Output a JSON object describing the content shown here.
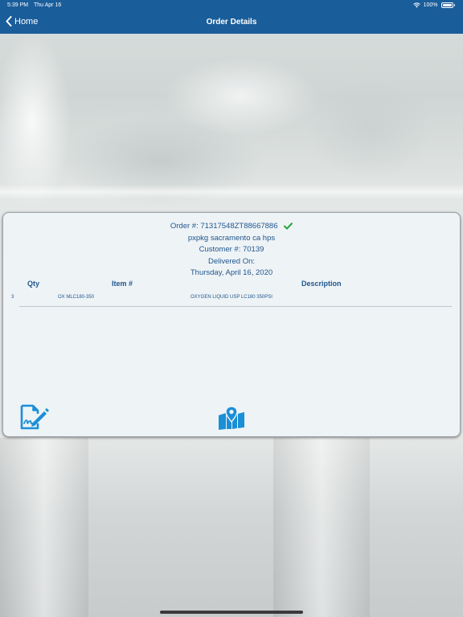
{
  "status_bar": {
    "time": "5:39 PM",
    "date": "Thu Apr 16",
    "battery": "100%"
  },
  "nav": {
    "back_label": "Home",
    "title": "Order Details"
  },
  "order": {
    "order_number": "Order #: 71317548ZT88667886",
    "location": "pxpkg sacramento ca hps",
    "customer": "Customer #: 70139",
    "delivered_label": "Delivered On:",
    "delivered_date": "Thursday, April 16, 2020"
  },
  "table": {
    "headers": {
      "qty": "Qty",
      "item": "Item #",
      "description": "Description"
    },
    "rows": [
      {
        "qty": "3",
        "item": "OX MLC180-350",
        "description": "OXYGEN LIQUID USP LC180 350PSI"
      }
    ]
  },
  "colors": {
    "nav_bar": "#1a5d9b",
    "text_blue": "#1f568c",
    "icon_blue": "#1a8fd6",
    "check_green": "#1fa637"
  },
  "icons": {
    "signature": "sign-document-icon",
    "map": "map-pin-icon",
    "delivered": "checkmark-icon"
  }
}
